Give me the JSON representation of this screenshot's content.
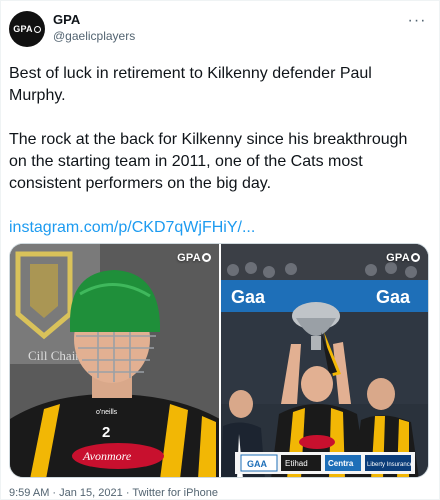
{
  "account": {
    "display_name": "GPA",
    "handle": "@gaelicplayers",
    "avatar_text": "GPA"
  },
  "tweet": {
    "paragraph_1": "Best of luck in retirement to Kilkenny defender Paul Murphy.",
    "paragraph_2": "The rock at the back for Kilkenny since his breakthrough on the starting team in 2011, one of the Cats most consistent performers on the big day.",
    "link": "instagram.com/p/CKD7qWjFHiY/..."
  },
  "media": {
    "left": {
      "watermark": "GPA",
      "logo_text": "Cill Chainnigh",
      "jersey_number": "2",
      "jersey_brand": "o'neills",
      "sponsor": "Avonmore"
    },
    "right": {
      "watermark": "GPA",
      "banner_text": "Gaa",
      "sponsors": [
        "GAA",
        "Etihad",
        "Centra",
        "Liberty Insurance"
      ]
    }
  },
  "meta": {
    "time": "9:59 AM",
    "date": "Jan 15, 2021",
    "source": "Twitter for iPhone"
  },
  "colors": {
    "link": "#1d9bf0",
    "secondary_text": "#536471",
    "kilkenny_amber": "#f2b705",
    "helmet_green": "#1f8f3a"
  },
  "icons": {
    "more": "more-horizontal-icon"
  }
}
